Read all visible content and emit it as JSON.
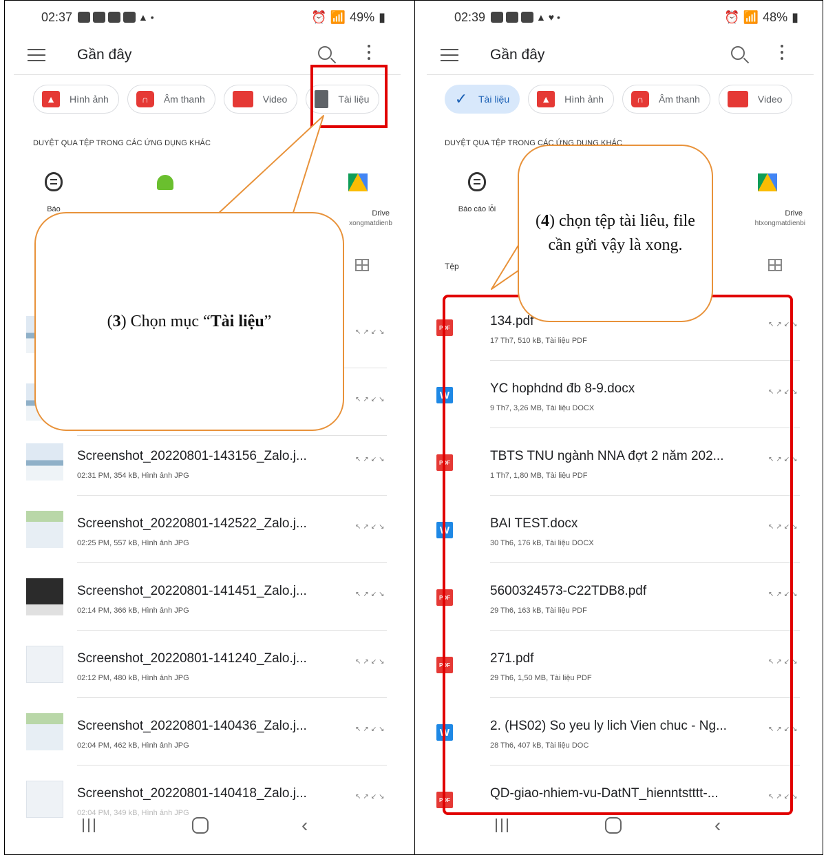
{
  "left": {
    "status": {
      "time": "02:37",
      "battery": "49%"
    },
    "title": "Gần đây",
    "chips": [
      "Hình ảnh",
      "Âm thanh",
      "Video",
      "Tài liệu"
    ],
    "section_label": "DUYỆT QUA TỆP TRONG CÁC ỨNG DỤNG KHÁC",
    "apps": [
      {
        "name": "Báo",
        "account": ""
      },
      {
        "name": "Drive",
        "account": "xongmatdienb"
      }
    ],
    "files": [
      {
        "name": "Screenshot_20220801-143156_Zalo.j...",
        "meta": "02:31 PM, 354 kB, Hình ảnh JPG"
      },
      {
        "name": "Screenshot_20220801-142522_Zalo.j...",
        "meta": "02:25 PM, 557 kB, Hình ảnh JPG"
      },
      {
        "name": "Screenshot_20220801-141451_Zalo.j...",
        "meta": "02:14 PM, 366 kB, Hình ảnh JPG"
      },
      {
        "name": "Screenshot_20220801-141240_Zalo.j...",
        "meta": "02:12 PM, 480 kB, Hình ảnh JPG"
      },
      {
        "name": "Screenshot_20220801-140436_Zalo.j...",
        "meta": "02:04 PM, 462 kB, Hình ảnh JPG"
      },
      {
        "name": "Screenshot_20220801-140418_Zalo.j...",
        "meta": "02:04 PM, 349 kB, Hình ảnh JPG"
      }
    ],
    "callout": {
      "num": "3",
      "pre": ") Chọn mục “",
      "bold": "Tài liệu",
      "post": "”"
    }
  },
  "right": {
    "status": {
      "time": "02:39",
      "battery": "48%"
    },
    "title": "Gần đây",
    "chips": [
      "Tài liệu",
      "Hình ảnh",
      "Âm thanh",
      "Video"
    ],
    "section_label": "DUYỆT QUA TỆP TRONG CÁC ỨNG DỤNG KHÁC",
    "apps": [
      {
        "name": "Báo cáo lỗi",
        "account": ""
      },
      {
        "name": "Drive",
        "account": "htxongmatdienbi"
      }
    ],
    "files_label": "Tệp",
    "files": [
      {
        "type": "pdf",
        "name": "134.pdf",
        "meta": "17 Th7, 510 kB, Tài liệu PDF"
      },
      {
        "type": "doc",
        "name": "YC hophdnd đb 8-9.docx",
        "meta": "9 Th7, 3,26 MB, Tài liệu DOCX"
      },
      {
        "type": "pdf",
        "name": "TBTS TNU ngành NNA đợt 2 năm 202...",
        "meta": "1 Th7, 1,80 MB, Tài liệu PDF"
      },
      {
        "type": "doc",
        "name": "BAI TEST.docx",
        "meta": "30 Th6, 176 kB, Tài liệu DOCX"
      },
      {
        "type": "pdf",
        "name": "5600324573-C22TDB8.pdf",
        "meta": "29 Th6, 163 kB, Tài liệu PDF"
      },
      {
        "type": "pdf",
        "name": "271.pdf",
        "meta": "29 Th6, 1,50 MB, Tài liệu PDF"
      },
      {
        "type": "doc",
        "name": "2. (HS02) So yeu ly lich Vien chuc - Ng...",
        "meta": "28 Th6, 407 kB, Tài liệu DOC"
      },
      {
        "type": "pdf",
        "name": "QD-giao-nhiem-vu-DatNT_hienntstttt-...",
        "meta": ""
      }
    ],
    "callout": {
      "num": "4",
      "text": ") chọn tệp tài liêu, file cần gửi vậy là xong."
    }
  },
  "icons": {
    "pdf_label": "PDF",
    "doc_label": "W",
    "check": "✓",
    "expand": "↖↗↙↘"
  }
}
